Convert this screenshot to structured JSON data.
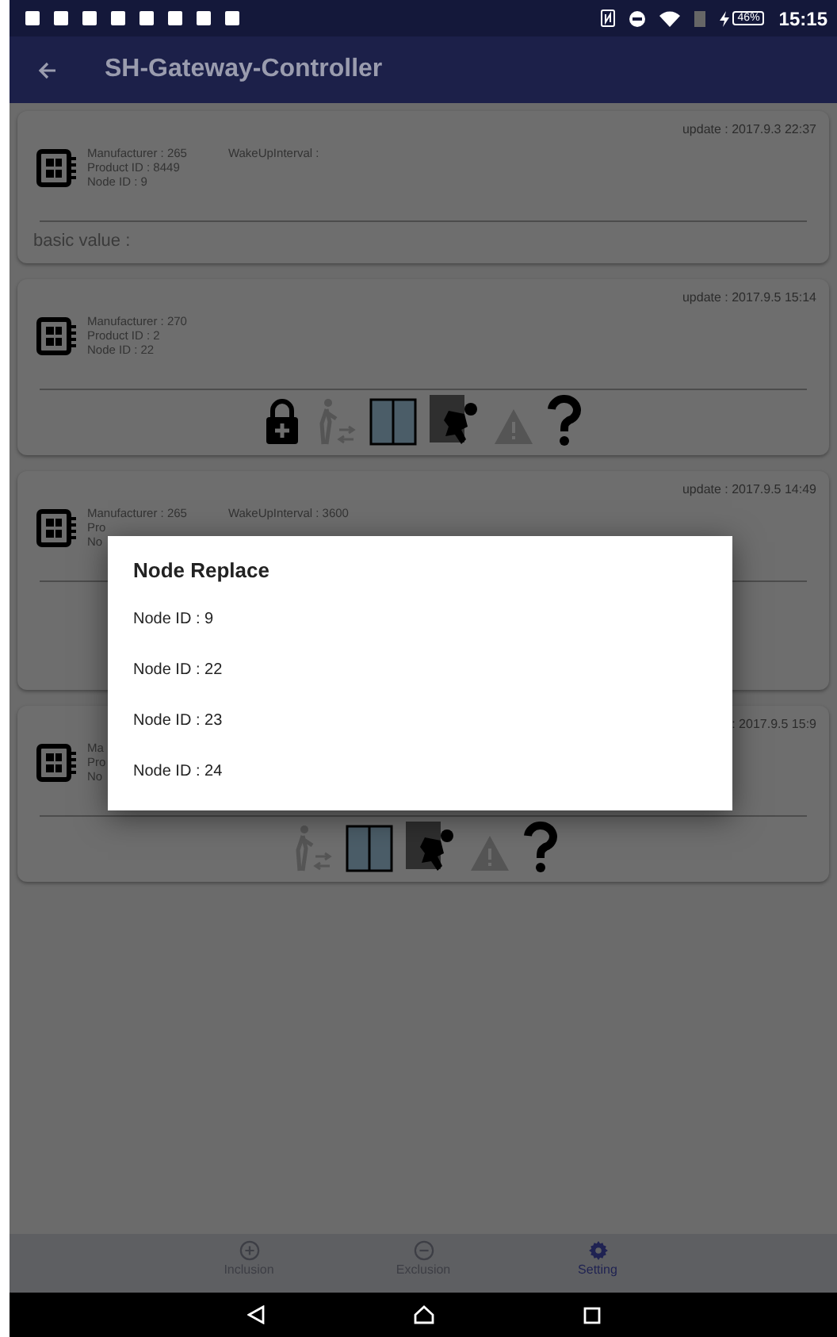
{
  "status_bar": {
    "battery": "46%",
    "time": "15:15"
  },
  "app_bar": {
    "title": "SH-Gateway-Controller"
  },
  "cards": [
    {
      "update": "update : 2017.9.3 22:37",
      "info": [
        "Manufacturer : 265",
        "Product ID : 8449",
        "Node ID : 9"
      ],
      "wakeup": "WakeUpInterval :",
      "basic_value": "basic value :"
    },
    {
      "update": "update : 2017.9.5 15:14",
      "info": [
        "Manufacturer : 270",
        "Product ID : 2",
        "Node ID : 22"
      ],
      "sensors": [
        {
          "kind": "lock",
          "active": true
        },
        {
          "kind": "walker",
          "active": false
        },
        {
          "kind": "door",
          "active": true
        },
        {
          "kind": "intruder",
          "active": true
        },
        {
          "kind": "warning",
          "active": false
        },
        {
          "kind": "question",
          "active": true
        }
      ]
    },
    {
      "update": "update : 2017.9.5 14:49",
      "info": [
        "Manufacturer : 265",
        "Pro",
        "No"
      ],
      "wakeup": "WakeUpInterval : 3600"
    },
    {
      "update": ": 2017.9.5 15:9",
      "info": [
        "Ma",
        "Pro",
        "No"
      ],
      "sensors": [
        {
          "kind": "walker",
          "active": false
        },
        {
          "kind": "door",
          "active": true
        },
        {
          "kind": "intruder",
          "active": true
        },
        {
          "kind": "warning",
          "active": false
        },
        {
          "kind": "question",
          "active": true
        }
      ]
    }
  ],
  "dialog": {
    "title": "Node Replace",
    "items": [
      "Node ID : 9",
      "Node ID : 22",
      "Node ID : 23",
      "Node ID : 24"
    ]
  },
  "bottom_nav": [
    {
      "kind": "plus",
      "label": "Inclusion",
      "selected": false
    },
    {
      "kind": "minus",
      "label": "Exclusion",
      "selected": false
    },
    {
      "kind": "gear",
      "label": "Setting",
      "selected": true
    }
  ]
}
